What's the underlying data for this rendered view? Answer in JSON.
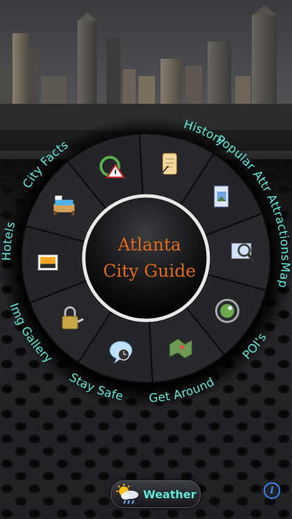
{
  "center": {
    "line1": "Atlanta",
    "line2": "City Guide"
  },
  "menu": [
    {
      "label": "History",
      "icon": "scroll-quill-icon"
    },
    {
      "label": "Popular Attr Attractions",
      "icon": "picture-frame-icon"
    },
    {
      "label": "Map",
      "icon": "magnifier-image-icon"
    },
    {
      "label": "POI's",
      "icon": "map-pin-icon"
    },
    {
      "label": "Get Around",
      "icon": "map-folded-icon"
    },
    {
      "label": "Stay Safe",
      "icon": "chat-clock-icon"
    },
    {
      "label": "Img Gallery",
      "icon": "padlock-keys-icon"
    },
    {
      "label": "Hotels",
      "icon": "photo-sunset-icon"
    },
    {
      "label": "City Facts",
      "icon": "bed-icon"
    },
    {
      "label": "",
      "icon": "sync-warning-icon"
    }
  ],
  "weather": {
    "label": "Weather",
    "icon": "sun-cloud-rain-icon"
  },
  "info": {
    "glyph": "i",
    "icon": "info-icon"
  },
  "colors": {
    "label": "#5fe7d9",
    "title": "#e26a1a",
    "info": "#3a86ff"
  }
}
